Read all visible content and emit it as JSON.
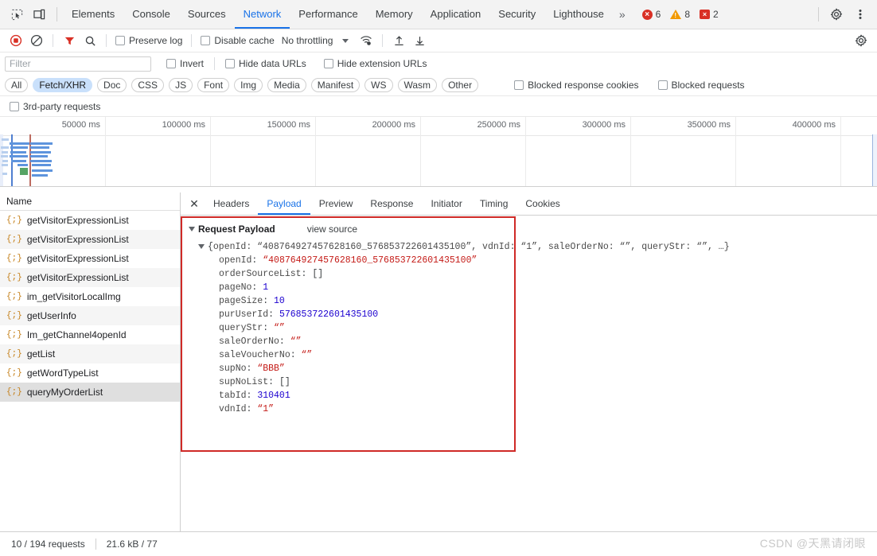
{
  "devtools": {
    "icons": {
      "inspect": "inspect-element-icon",
      "device": "device-toolbar-icon",
      "settings": "gear-icon",
      "more": "kebab-menu-icon"
    },
    "panels": [
      {
        "label": "Elements",
        "active": false
      },
      {
        "label": "Console",
        "active": false
      },
      {
        "label": "Sources",
        "active": false
      },
      {
        "label": "Network",
        "active": true
      },
      {
        "label": "Performance",
        "active": false
      },
      {
        "label": "Memory",
        "active": false
      },
      {
        "label": "Application",
        "active": false
      },
      {
        "label": "Security",
        "active": false
      },
      {
        "label": "Lighthouse",
        "active": false
      }
    ],
    "more_panels_label": "»",
    "counters": {
      "errors": "6",
      "warnings": "8",
      "messages": "2"
    }
  },
  "network_toolbar": {
    "record_icon": "record-stop-icon",
    "clear_icon": "clear-network-log-icon",
    "filter_icon": "filter-funnel-icon",
    "search_icon": "search-icon",
    "preserve_log_label": "Preserve log",
    "disable_cache_label": "Disable cache",
    "throttling_value": "No throttling",
    "throttling_settings_icon": "wifi-throttle-icon",
    "import_icon": "import-har-upload-icon",
    "export_icon": "export-har-download-icon",
    "settings_icon": "gear-icon"
  },
  "filter_row": {
    "filter_placeholder": "Filter",
    "filter_value": "",
    "invert_label": "Invert",
    "hide_data_urls_label": "Hide data URLs",
    "hide_extension_urls_label": "Hide extension URLs"
  },
  "type_filters": [
    {
      "label": "All",
      "active": false
    },
    {
      "label": "Fetch/XHR",
      "active": true
    },
    {
      "label": "Doc",
      "active": false
    },
    {
      "label": "CSS",
      "active": false
    },
    {
      "label": "JS",
      "active": false
    },
    {
      "label": "Font",
      "active": false
    },
    {
      "label": "Img",
      "active": false
    },
    {
      "label": "Media",
      "active": false
    },
    {
      "label": "Manifest",
      "active": false
    },
    {
      "label": "WS",
      "active": false
    },
    {
      "label": "Wasm",
      "active": false
    },
    {
      "label": "Other",
      "active": false
    }
  ],
  "extra_filters": {
    "blocked_response_cookies_label": "Blocked response cookies",
    "blocked_requests_label": "Blocked requests",
    "third_party_label": "3rd-party requests"
  },
  "overview": {
    "ticks": [
      "50000 ms",
      "100000 ms",
      "150000 ms",
      "200000 ms",
      "250000 ms",
      "300000 ms",
      "350000 ms",
      "400000 ms"
    ]
  },
  "requests": {
    "column_header": "Name",
    "rows": [
      {
        "name": "getVisitorExpressionList",
        "selected": false
      },
      {
        "name": "getVisitorExpressionList",
        "selected": false
      },
      {
        "name": "getVisitorExpressionList",
        "selected": false
      },
      {
        "name": "getVisitorExpressionList",
        "selected": false
      },
      {
        "name": "im_getVisitorLocalImg",
        "selected": false
      },
      {
        "name": "getUserInfo",
        "selected": false
      },
      {
        "name": "Im_getChannel4openId",
        "selected": false
      },
      {
        "name": "getList",
        "selected": false
      },
      {
        "name": "getWordTypeList",
        "selected": false
      },
      {
        "name": "queryMyOrderList",
        "selected": true
      }
    ]
  },
  "detail": {
    "close_label": "✕",
    "tabs": [
      {
        "label": "Headers",
        "active": false
      },
      {
        "label": "Payload",
        "active": true
      },
      {
        "label": "Preview",
        "active": false
      },
      {
        "label": "Response",
        "active": false
      },
      {
        "label": "Initiator",
        "active": false
      },
      {
        "label": "Timing",
        "active": false
      },
      {
        "label": "Cookies",
        "active": false
      }
    ],
    "payload": {
      "section_title": "Request Payload",
      "view_source_label": "view source",
      "root_preview": {
        "open_brace": "{",
        "inline": "openId: “408764927457628160_576853722601435100”, vdnId: “1”, saleOrderNo: “”, queryStr: “”, …}"
      },
      "entries": [
        {
          "key": "openId",
          "value": "“408764927457628160_576853722601435100”",
          "kind": "string"
        },
        {
          "key": "orderSourceList",
          "value": "[]",
          "kind": "punct"
        },
        {
          "key": "pageNo",
          "value": "1",
          "kind": "number"
        },
        {
          "key": "pageSize",
          "value": "10",
          "kind": "number"
        },
        {
          "key": "purUserId",
          "value": "576853722601435100",
          "kind": "number"
        },
        {
          "key": "queryStr",
          "value": "“”",
          "kind": "string"
        },
        {
          "key": "saleOrderNo",
          "value": "“”",
          "kind": "string"
        },
        {
          "key": "saleVoucherNo",
          "value": "“”",
          "kind": "string"
        },
        {
          "key": "supNo",
          "value": "“BBB”",
          "kind": "string"
        },
        {
          "key": "supNoList",
          "value": "[]",
          "kind": "punct"
        },
        {
          "key": "tabId",
          "value": "310401",
          "kind": "number"
        },
        {
          "key": "vdnId",
          "value": "“1”",
          "kind": "string"
        }
      ]
    }
  },
  "status": {
    "requests": "10 / 194 requests",
    "transferred": "21.6 kB / 77"
  },
  "watermark": "CSDN @天黑请闭眼",
  "colors": {
    "accent": "#1a73e8",
    "chip_active": "#c9e0fb",
    "annotation": "#cf2a27",
    "error": "#d93025",
    "warning": "#f29900"
  }
}
